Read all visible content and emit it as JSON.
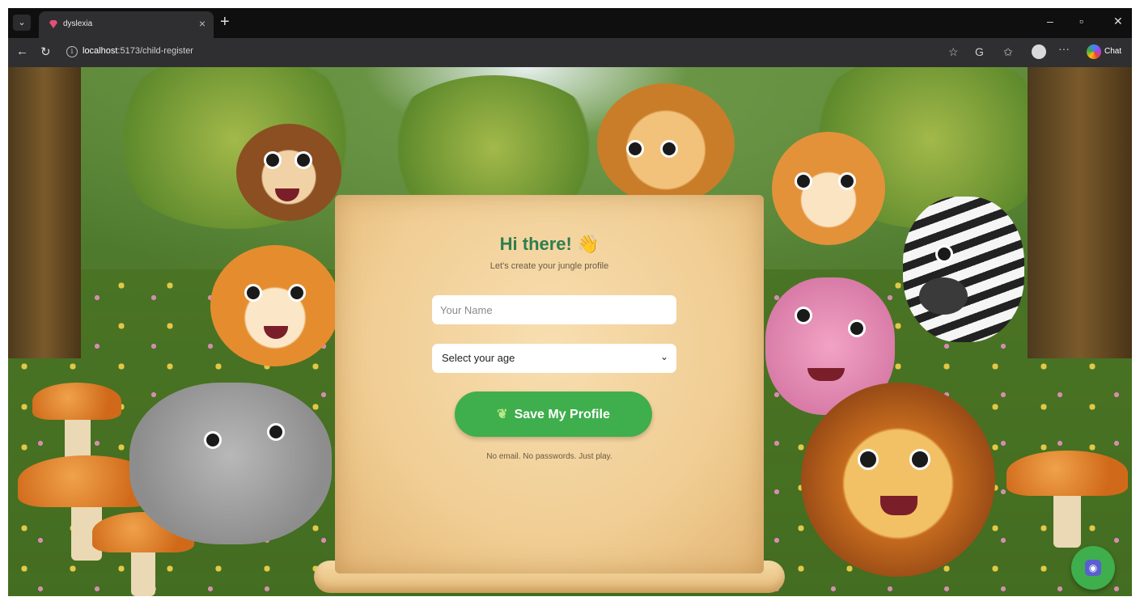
{
  "browser": {
    "tab_title": "dyslexia",
    "url_host": "localhost",
    "url_path": ":5173/child-register",
    "chat_label": "Chat"
  },
  "page": {
    "title": "Hi there! 👋",
    "subtitle": "Let's create your jungle profile",
    "name_placeholder": "Your Name",
    "age_selected": "Select your age",
    "save_button": "Save My Profile",
    "footnote": "No email. No passwords. Just play.",
    "accent_green": "#3fae4c",
    "title_green": "#2e7d4f"
  },
  "icons": [
    "menu-icon",
    "close-icon",
    "plus-icon",
    "minimize-icon",
    "maximize-icon",
    "back-icon",
    "refresh-icon",
    "info-icon",
    "star-icon",
    "tracking-icon",
    "favorites-icon",
    "more-icon",
    "sprout-icon",
    "chatbot-icon"
  ]
}
